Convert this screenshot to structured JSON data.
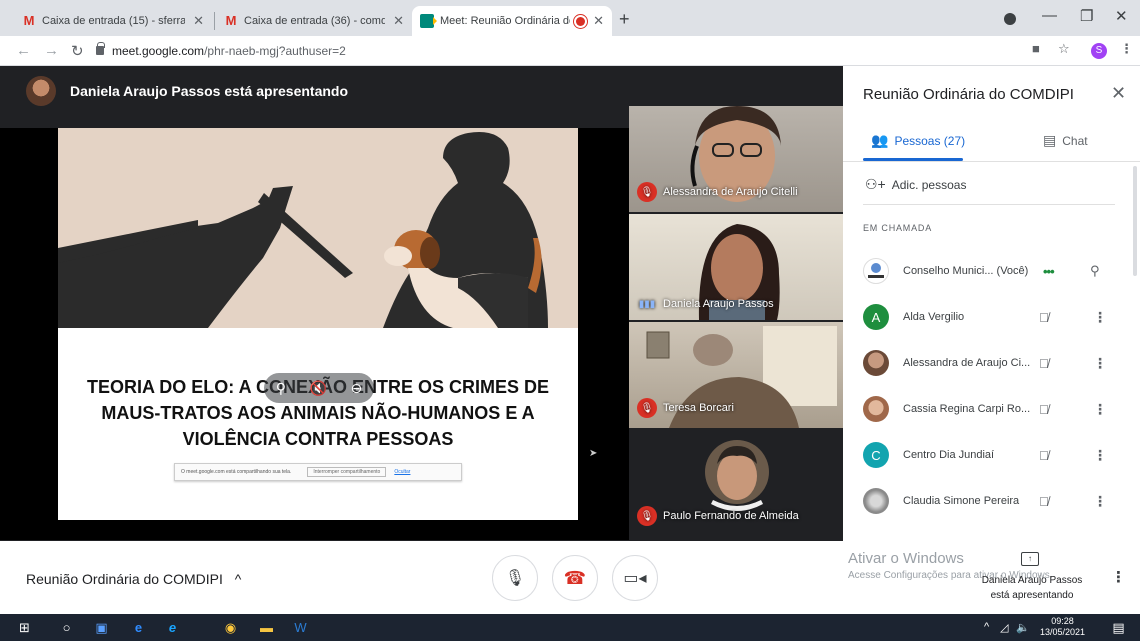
{
  "browser": {
    "tabs": [
      {
        "title": "Caixa de entrada (15) - sferraz@",
        "icon": "gmail-icon"
      },
      {
        "title": "Caixa de entrada (36) - comdipi@",
        "icon": "gmail-icon"
      },
      {
        "title": "Meet: Reunião Ordinária do",
        "icon": "meet-icon"
      }
    ],
    "new_tab": "+",
    "url_host": "meet.google.com",
    "url_path": "/phr-naeb-mgj?authuser=2",
    "profile_initial": "S"
  },
  "presentation": {
    "presenter_text": "Daniela Araujo Passos está apresentando",
    "slide_title_lines": [
      "TEORIA DO ELO: A CONEXÃO ENTRE OS CRIMES DE",
      "MAUS-TRATOS AOS ANIMAIS NÃO-HUMANOS E A",
      "VIOLÊNCIA CONTRA PESSOAS"
    ],
    "share_banner": {
      "text": "O meet.google.com está compartilhando sua tela.",
      "stop": "Interromper compartilhamento",
      "hide": "Ocultar"
    }
  },
  "tiles": [
    {
      "name": "Alessandra de Araujo Citelli",
      "muted": true
    },
    {
      "name": "Daniela Araujo Passos",
      "muted": false
    },
    {
      "name": "Teresa Borcari",
      "muted": true
    },
    {
      "name": "Paulo Fernando de Almeida",
      "muted": true
    }
  ],
  "panel": {
    "title": "Reunião Ordinária do COMDIPI",
    "people_tab": "Pessoas (27)",
    "chat_tab": "Chat",
    "add_people": "Adic. pessoas",
    "section": "EM CHAMADA",
    "people": [
      {
        "name": "Conselho Munici... (Você)",
        "initial": "",
        "color": "#ffffff",
        "self": true
      },
      {
        "name": "Alda Vergilio",
        "initial": "A",
        "color": "#1e8e3e",
        "self": false
      },
      {
        "name": "Alessandra de Araujo Ci...",
        "initial": "",
        "color": "#8d6e63",
        "self": false
      },
      {
        "name": "Cassia Regina Carpi Ro...",
        "initial": "",
        "color": "#a1887f",
        "self": false
      },
      {
        "name": "Centro Dia Jundiaí",
        "initial": "C",
        "color": "#12a4af",
        "self": false
      },
      {
        "name": "Claudia Simone Pereira",
        "initial": "",
        "color": "#9e9e9e",
        "self": false
      }
    ]
  },
  "bottom": {
    "meeting_name": "Reunião Ordinária do COMDIPI",
    "activate_line1": "Ativar o Windows",
    "activate_line2": "Acesse Configurações para ativar o Windows.",
    "presenting_line1": "Daniela Araujo Passos",
    "presenting_line2": "está apresentando"
  },
  "taskbar": {
    "time": "09:28",
    "date": "13/05/2021"
  }
}
